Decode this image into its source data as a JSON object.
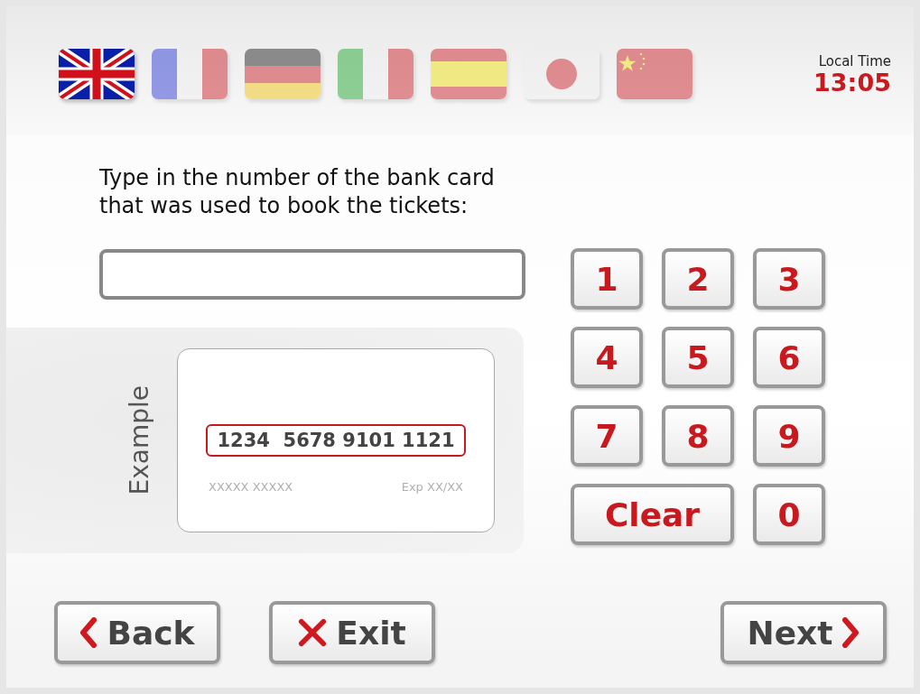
{
  "languages": [
    {
      "kind": "uk",
      "selected": true
    },
    {
      "kind": "fr",
      "selected": false
    },
    {
      "kind": "de",
      "selected": false
    },
    {
      "kind": "it",
      "selected": false
    },
    {
      "kind": "es",
      "selected": false
    },
    {
      "kind": "jp",
      "selected": false
    },
    {
      "kind": "cn",
      "selected": false
    }
  ],
  "clock": {
    "label": "Local Time",
    "time": "13:05"
  },
  "prompt": "Type in the number of the bank card\nthat was used to book the tickets:",
  "example": {
    "label": "Example",
    "number": "1234  5678 9101 1121",
    "name": "XXXXX XXXXX",
    "expiry": "Exp XX/XX"
  },
  "keypad": [
    {
      "kind": "digit",
      "label": "1"
    },
    {
      "kind": "digit",
      "label": "2"
    },
    {
      "kind": "digit",
      "label": "3"
    },
    {
      "kind": "digit",
      "label": "4"
    },
    {
      "kind": "digit",
      "label": "5"
    },
    {
      "kind": "digit",
      "label": "6"
    },
    {
      "kind": "digit",
      "label": "7"
    },
    {
      "kind": "digit",
      "label": "8"
    },
    {
      "kind": "digit",
      "label": "9"
    },
    {
      "kind": "clear",
      "label": "Clear"
    },
    {
      "kind": "digit",
      "label": "0"
    }
  ],
  "nav_buttons": [
    {
      "kind": "back",
      "label": "Back"
    },
    {
      "kind": "exit",
      "label": "Exit"
    },
    {
      "kind": "next",
      "label": "Next"
    }
  ]
}
